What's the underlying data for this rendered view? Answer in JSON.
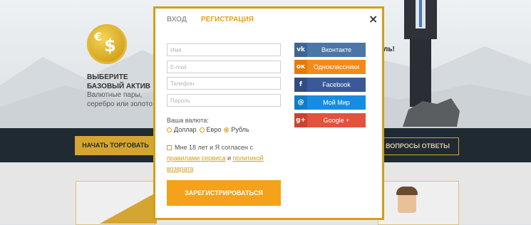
{
  "background": {
    "coin_symbols": [
      "€",
      "$"
    ],
    "promo_title": "ВЫБЕРИТЕ БАЗОВЫЙ АКТИВ",
    "promo_desc": "Валютные пары, серебро или золото.",
    "right_snippet": "ль!",
    "start_trading_label": "НАЧАТЬ ТОРГОВАТЬ",
    "faq_label": "ВОПРОСЫ ОТВЕТЫ",
    "accent_color": "#d5a531",
    "band_color": "#1f2a33"
  },
  "modal": {
    "tabs": [
      {
        "label": "ВХОД",
        "active": false
      },
      {
        "label": "РЕГИСТРАЦИЯ",
        "active": true
      }
    ],
    "close_symbol": "×",
    "fields": [
      {
        "placeholder": "Имя",
        "value": ""
      },
      {
        "placeholder": "E-mail",
        "value": ""
      },
      {
        "placeholder": "Телефон",
        "value": ""
      },
      {
        "placeholder": "Пароль",
        "value": ""
      }
    ],
    "currency_label": "Ваша валюта:",
    "currency_options": [
      {
        "label": "Доллар",
        "selected": false
      },
      {
        "label": "Евро",
        "selected": false
      },
      {
        "label": "Рубль",
        "selected": true
      }
    ],
    "agree_prefix": "Мне 18 лет и Я согласен с",
    "agree_link1": "правилами сервиса",
    "agree_and": "и",
    "agree_link2": "политикой возврата",
    "submit_label": "ЗАРЕГИСТРИРОВАТЬСЯ",
    "submit_color": "#f4a21a",
    "social": [
      {
        "name": "vk",
        "icon_text": "vk",
        "label": "Вконтакте",
        "color": "#4a76a8",
        "icon_bg": "#3e6593",
        "icon": "vk-icon"
      },
      {
        "name": "ok",
        "icon_text": "ок",
        "label": "Одноклассники",
        "color": "#f28a1a",
        "icon_bg": "#e67a08",
        "icon": "odnoklassniki-icon"
      },
      {
        "name": "facebook",
        "icon_text": "f",
        "label": "Facebook",
        "color": "#3b5998",
        "icon_bg": "#324c82",
        "icon": "facebook-icon"
      },
      {
        "name": "mymir",
        "icon_text": "@",
        "label": "Мой Мир",
        "color": "#168de2",
        "icon_bg": "#0f7cc8",
        "icon": "mymir-icon"
      },
      {
        "name": "google",
        "icon_text": "g+",
        "label": "Google +",
        "color": "#e1523f",
        "icon_bg": "#c9432f",
        "icon": "google-plus-icon"
      }
    ]
  }
}
